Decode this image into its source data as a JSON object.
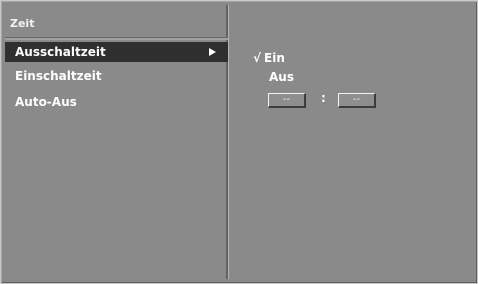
{
  "menu": {
    "title": "Zeit",
    "items": [
      {
        "label": "Ausschaltzeit",
        "selected": true,
        "has_submenu": true
      },
      {
        "label": "Einschaltzeit",
        "selected": false
      },
      {
        "label": "Auto-Aus",
        "selected": false
      }
    ]
  },
  "submenu": {
    "checkmark": "√",
    "options": [
      {
        "label": "Ein",
        "checked": true
      },
      {
        "label": "Aus",
        "checked": false
      }
    ],
    "time": {
      "hours": "--",
      "separator": ":",
      "minutes": "--"
    }
  },
  "colors": {
    "panel_bg": "#8a8a8a",
    "highlight_bg": "#2f2f2f",
    "text": "#ffffff"
  }
}
